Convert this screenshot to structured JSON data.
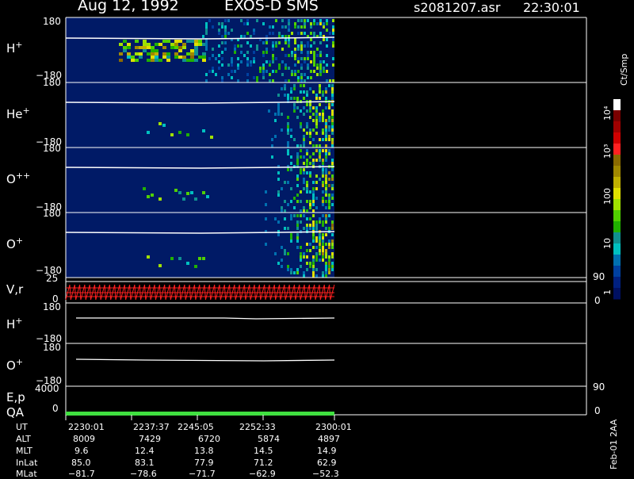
{
  "header": {
    "date": "Aug 12, 1992",
    "instrument": "EXOS-D SMS",
    "file": "s2081207.asr",
    "time": "22:30:01"
  },
  "colorbar": {
    "unit": "Ct/Smp",
    "ticks": [
      "10⁴",
      "10³",
      "100",
      "10",
      "1"
    ],
    "colors": [
      "#ffffff",
      "#7a0000",
      "#a00000",
      "#d00000",
      "#ff2020",
      "#8a6a00",
      "#a08800",
      "#c0b000",
      "#e0e000",
      "#a0e000",
      "#50d000",
      "#20b000",
      "#109090",
      "#00c0c0",
      "#0070b0",
      "#0040a0",
      "#002080",
      "#001060"
    ]
  },
  "footer_code": "Feb-01 2AA",
  "panels": [
    {
      "label": "H",
      "charge": "+",
      "ymax": "180",
      "ymin": "−180"
    },
    {
      "label": "He",
      "charge": "+",
      "ymax": "180",
      "ymin": "−180"
    },
    {
      "label": "O",
      "charge": "++",
      "ymax": "180",
      "ymin": "−180"
    },
    {
      "label": "O",
      "charge": "+",
      "ymax": "180",
      "ymin": "−180"
    }
  ],
  "vr": {
    "label": "V,r",
    "ymax": "25",
    "ymin": "0",
    "right_top": "90",
    "right_bottom": "0",
    "color": "#ff2020"
  },
  "line_panels": [
    {
      "label": "H",
      "charge": "+",
      "ymax": "180",
      "ymin": "−180"
    },
    {
      "label": "O",
      "charge": "+",
      "ymax": "180",
      "ymin": "−180"
    }
  ],
  "ep": {
    "label": "E,p",
    "ymax": "4000",
    "right_top": "90"
  },
  "qa": {
    "label": "QA",
    "ymin": "0",
    "right_bottom": "0",
    "color": "#40e040"
  },
  "table": {
    "rows": [
      {
        "label": "UT",
        "values": [
          "2230:01",
          "2237:37",
          "2245:05",
          "2252:33",
          "2300:01"
        ]
      },
      {
        "label": "ALT",
        "values": [
          "8009",
          "7429",
          "6720",
          "5874",
          "4897"
        ]
      },
      {
        "label": "MLT",
        "values": [
          "9.6",
          "12.4",
          "13.8",
          "14.5",
          "14.9"
        ]
      },
      {
        "label": "InLat",
        "values": [
          "85.0",
          "83.1",
          "77.9",
          "71.2",
          "62.9"
        ]
      },
      {
        "label": "MLat",
        "values": [
          "−81.7",
          "−78.6",
          "−71.7",
          "−62.9",
          "−52.3"
        ]
      }
    ]
  },
  "chart_data": {
    "type": "heatmap",
    "title": "Aug 12, 1992   EXOS-D SMS",
    "x_ticks": [
      "2230:01",
      "2237:37",
      "2245:05",
      "2252:33",
      "2300:01"
    ],
    "data_end_fraction": 0.49,
    "panels": [
      "H+",
      "He+",
      "O++",
      "O+"
    ],
    "y_range": [
      -180,
      180
    ],
    "colorbar_unit": "Ct/Smp",
    "grid": false,
    "legend": "right"
  }
}
